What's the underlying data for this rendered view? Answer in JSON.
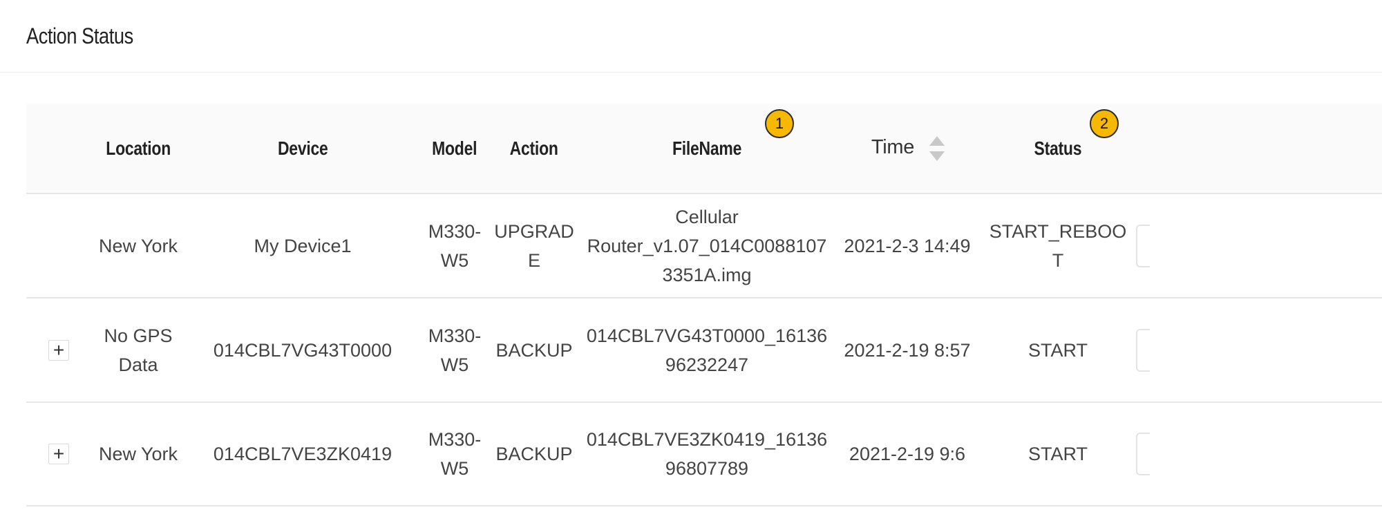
{
  "header": {
    "title": "Action Status"
  },
  "table": {
    "columns": {
      "location": "Location",
      "device": "Device",
      "model": "Model",
      "action": "Action",
      "filename": "FileName",
      "time": "Time",
      "status": "Status"
    },
    "badges": {
      "filename": "1",
      "status": "2"
    },
    "rows": [
      {
        "expandable": false,
        "location": "New York",
        "device": "My Device1",
        "model": "M330-W5",
        "action": "UPGRADE",
        "filename": "Cellular Router_v1.07_014C00881073351A.img",
        "time": "2021-2-3 14:49",
        "status": "START_REBOOT"
      },
      {
        "expandable": true,
        "expand_icon": "+",
        "location": "No GPS Data",
        "device": "014CBL7VG43T0000",
        "model": "M330-W5",
        "action": "BACKUP",
        "filename": "014CBL7VG43T0000_1613696232247",
        "time": "2021-2-19 8:57",
        "status": "START"
      },
      {
        "expandable": true,
        "expand_icon": "+",
        "location": "New York",
        "device": "014CBL7VE3ZK0419",
        "model": "M330-W5",
        "action": "BACKUP",
        "filename": "014CBL7VE3ZK0419_1613696807789",
        "time": "2021-2-19 9:6",
        "status": "START"
      }
    ]
  },
  "colors": {
    "badge": "#f6b900",
    "header_bg": "#fafafa",
    "divider": "#e6e6e6"
  }
}
